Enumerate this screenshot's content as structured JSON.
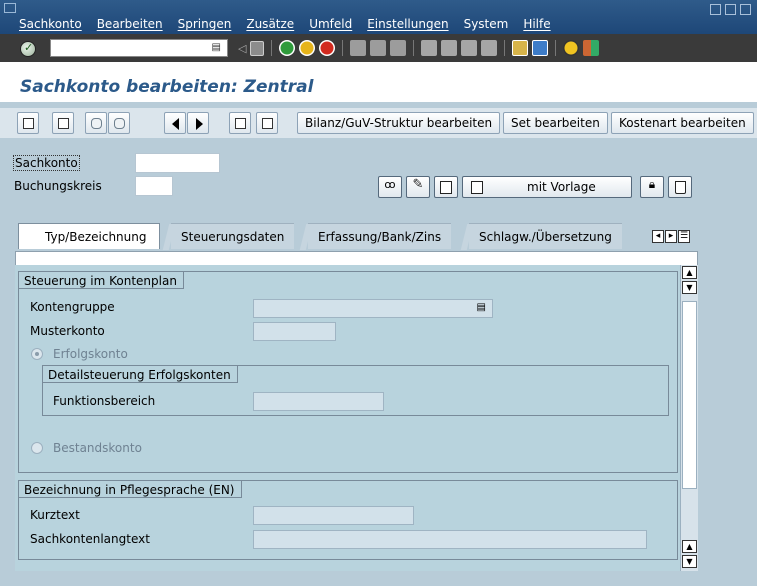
{
  "menubar": {
    "items": [
      "Sachkonto",
      "Bearbeiten",
      "Springen",
      "Zusätze",
      "Umfeld",
      "Einstellungen",
      "System",
      "Hilfe"
    ]
  },
  "std_toolbar": {
    "command_field_value": "",
    "icons": [
      "back-icon",
      "exit-icon",
      "cancel-icon",
      "print-icon",
      "find-icon",
      "find-next-icon",
      "first-page-icon",
      "previous-page-icon",
      "next-page-icon",
      "last-page-icon",
      "create-session-icon",
      "shortcut-icon",
      "help-icon",
      "layout-menu-icon"
    ]
  },
  "screen": {
    "title": "Sachkonto bearbeiten: Zentral"
  },
  "app_toolbar": {
    "btn_bilanz": "Bilanz/GuV-Struktur bearbeiten",
    "btn_set": "Set bearbeiten",
    "btn_kostenart": "Kostenart bearbeiten"
  },
  "header": {
    "sachkonto_label": "Sachkonto",
    "sachkonto_value": "",
    "buchungskreis_label": "Buchungskreis",
    "buchungskreis_value": "",
    "mit_vorlage_label": "mit Vorlage"
  },
  "tabs": [
    "Typ/Bezeichnung",
    "Steuerungsdaten",
    "Erfassung/Bank/Zins",
    "Schlagw./Übersetzung"
  ],
  "steuerung": {
    "title": "Steuerung im Kontenplan",
    "kontengruppe_label": "Kontengruppe",
    "kontengruppe_value": "",
    "musterkonto_label": "Musterkonto",
    "musterkonto_value": "",
    "erfolgskonto_label": "Erfolgskonto",
    "detail_title": "Detailsteuerung Erfolgskonten",
    "funktionsbereich_label": "Funktionsbereich",
    "funktionsbereich_value": "",
    "bestandskonto_label": "Bestandskonto"
  },
  "bezeichnung": {
    "title": "Bezeichnung in Pflegesprache (EN)",
    "kurztext_label": "Kurztext",
    "kurztext_value": "",
    "langtext_label": "Sachkontenlangtext",
    "langtext_value": ""
  }
}
